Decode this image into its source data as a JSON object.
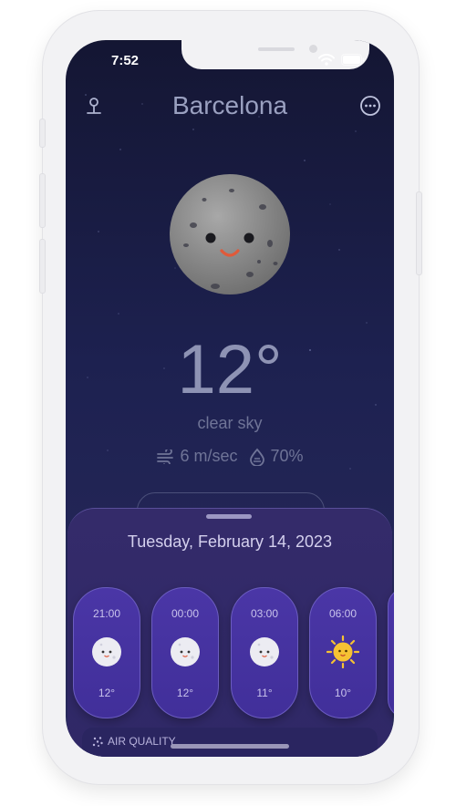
{
  "status_bar": {
    "time": "7:52"
  },
  "header": {
    "city": "Barcelona",
    "location_icon": "location-pin-icon",
    "more_icon": "more-circle-icon"
  },
  "current": {
    "temperature": "12°",
    "condition": "clear sky",
    "wind": "6 m/sec",
    "humidity": "70%",
    "icon": "moon-face-icon"
  },
  "forecast_sheet": {
    "date": "Tuesday, February 14, 2023",
    "hours": [
      {
        "time": "21:00",
        "temp": "12°",
        "icon": "moon-face-icon"
      },
      {
        "time": "00:00",
        "temp": "12°",
        "icon": "moon-face-icon"
      },
      {
        "time": "03:00",
        "temp": "11°",
        "icon": "moon-face-icon"
      },
      {
        "time": "06:00",
        "temp": "10°",
        "icon": "sun-face-icon"
      }
    ]
  },
  "air_quality": {
    "label": "AIR QUALITY",
    "icon": "air-quality-icon"
  },
  "colors": {
    "sky_top": "#141633",
    "sky_bottom": "#2a2b5e",
    "sheet": "#342b6a",
    "hour_card": "#4a36a6",
    "sun": "#f6c233"
  }
}
